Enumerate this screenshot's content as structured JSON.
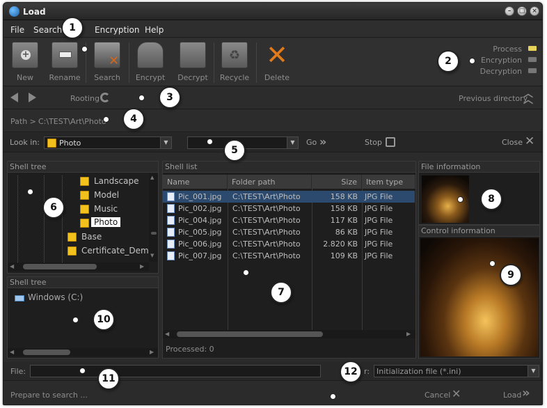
{
  "window": {
    "title": "Load"
  },
  "menu": [
    "File",
    "Search",
    "Encryption",
    "Help"
  ],
  "toolbar": {
    "new": "New",
    "rename": "Rename",
    "search": "Search",
    "encrypt": "Encrypt",
    "decrypt": "Decrypt",
    "recycle": "Recycle",
    "delete": "Delete"
  },
  "indicators": {
    "process": "Process",
    "encryption": "Encryption",
    "decryption": "Decryption"
  },
  "nav": {
    "rooting": "Rooting",
    "previous": "Previous directory"
  },
  "path": {
    "label": "Path >",
    "value": "C:\\TEST\\Art\\Photo"
  },
  "lookin": {
    "label": "Look in:",
    "value": "Photo",
    "go": "Go",
    "stop": "Stop",
    "close": "Close"
  },
  "shell_tree": {
    "title": "Shell tree",
    "items": [
      "Landscape",
      "Model",
      "Music",
      "Photo",
      "Base",
      "Certificate_Demo"
    ]
  },
  "shell_tree2": {
    "title": "Shell tree",
    "drive": "Windows (C:)"
  },
  "shell_list": {
    "title": "Shell list",
    "columns": [
      "Name",
      "Folder path",
      "Size",
      "Item type"
    ],
    "rows": [
      [
        "Pic_001.jpg",
        "C:\\TEST\\Art\\Photo",
        "158 KB",
        "JPG File"
      ],
      [
        "Pic_002.jpg",
        "C:\\TEST\\Art\\Photo",
        "158 KB",
        "JPG File"
      ],
      [
        "Pic_004.jpg",
        "C:\\TEST\\Art\\Photo",
        "117 KB",
        "JPG File"
      ],
      [
        "Pic_005.jpg",
        "C:\\TEST\\Art\\Photo",
        "86 KB",
        "JPG File"
      ],
      [
        "Pic_006.jpg",
        "C:\\TEST\\Art\\Photo",
        "2.820 KB",
        "JPG File"
      ],
      [
        "Pic_007.jpg",
        "C:\\TEST\\Art\\Photo",
        "109 KB",
        "JPG File"
      ]
    ],
    "processed": "Processed: 0"
  },
  "file_info": {
    "title": "File information"
  },
  "control_info": {
    "title": "Control information"
  },
  "file": {
    "label": "File:",
    "filter": "Initialization file (*.ini)",
    "filter_prefix": "r:"
  },
  "status": {
    "text": "Prepare to search ...",
    "cancel": "Cancel",
    "load": "Load"
  },
  "callouts": [
    "1",
    "2",
    "3",
    "4",
    "5",
    "6",
    "7",
    "8",
    "9",
    "10",
    "11",
    "12"
  ],
  "colors": {
    "accent": "#f2c11b",
    "selection": "#2c4a6e",
    "indicator_on": "#e8d35a"
  }
}
